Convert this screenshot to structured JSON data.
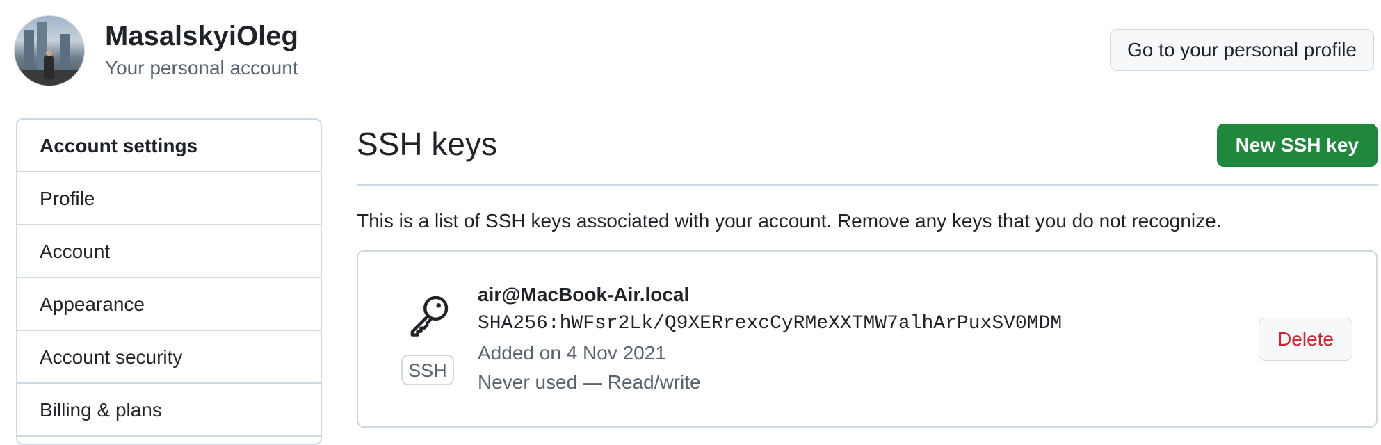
{
  "header": {
    "username": "MasalskyiOleg",
    "account_type": "Your personal account",
    "profile_button": "Go to your personal profile"
  },
  "sidebar": {
    "heading": "Account settings",
    "items": [
      {
        "label": "Profile"
      },
      {
        "label": "Account"
      },
      {
        "label": "Appearance"
      },
      {
        "label": "Account security"
      },
      {
        "label": "Billing & plans"
      }
    ]
  },
  "main": {
    "title": "SSH keys",
    "new_key_button": "New SSH key",
    "description": "This is a list of SSH keys associated with your account. Remove any keys that you do not recognize."
  },
  "ssh_key": {
    "badge": "SSH",
    "name": "air@MacBook-Air.local",
    "fingerprint": "SHA256:hWFsr2Lk/Q9XERrexcCyRMeXXTMW7alhArPuxSV0MDM",
    "added": "Added on 4 Nov 2021",
    "usage": "Never used — Read/write",
    "delete_button": "Delete",
    "icon": "key-icon"
  },
  "colors": {
    "primary_button": "#1f883d",
    "danger_text": "#cf222e",
    "border": "#d1d9e0",
    "muted_text": "#59636e"
  }
}
